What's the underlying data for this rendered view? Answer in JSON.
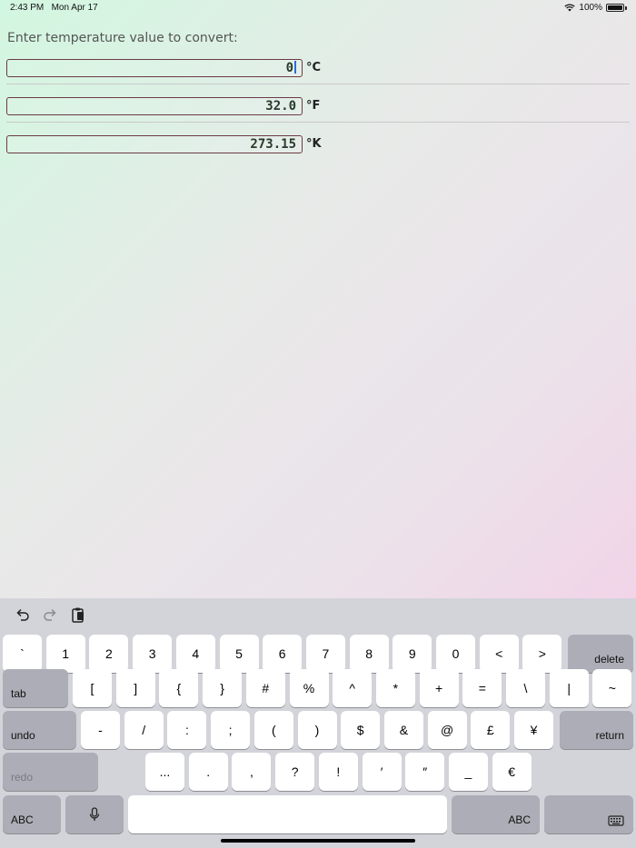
{
  "status_bar": {
    "time": "2:43 PM",
    "date": "Mon Apr 17",
    "battery": "100%"
  },
  "prompt": "Enter temperature value to convert:",
  "conversions": [
    {
      "value": "0",
      "unit": "°C",
      "focused": true
    },
    {
      "value": "32.0",
      "unit": "°F",
      "focused": false
    },
    {
      "value": "273.15",
      "unit": "°K",
      "focused": false
    }
  ],
  "keyboard": {
    "toolbar_icons": [
      "undo-icon",
      "redo-icon",
      "paste-icon"
    ],
    "row1": [
      "`",
      "1",
      "2",
      "3",
      "4",
      "5",
      "6",
      "7",
      "8",
      "9",
      "0",
      "<",
      ">"
    ],
    "row1_end": "delete",
    "row2_start": "tab",
    "row2": [
      "[",
      "]",
      "{",
      "}",
      "#",
      "%",
      "^",
      "*",
      "+",
      "=",
      "\\",
      "|",
      "~"
    ],
    "row3_start": "undo",
    "row3": [
      "-",
      "/",
      ":",
      ";",
      "(",
      ")",
      "$",
      "&",
      "@",
      "£",
      "¥"
    ],
    "row3_end": "return",
    "row4_start": "redo",
    "row4": [
      "...",
      ".",
      ",",
      "?",
      "!",
      "′",
      "″",
      "_",
      "€"
    ],
    "row5_left": "ABC",
    "row5_right": "ABC",
    "icons": [
      "microphone-icon",
      "keyboard-dismiss-icon"
    ]
  }
}
